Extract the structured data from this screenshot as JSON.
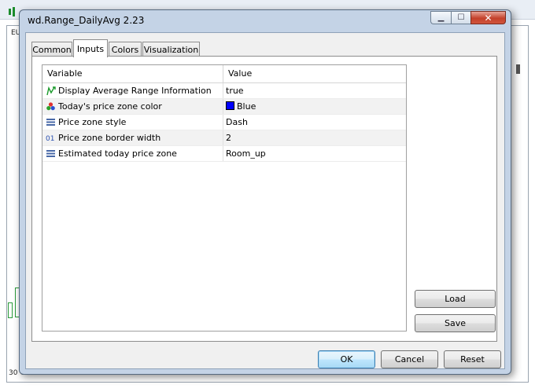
{
  "window": {
    "title": "wd.Range_DailyAvg 2.23",
    "minimize_glyph": "▁",
    "maximize_glyph": "☐",
    "close_glyph": "✕"
  },
  "background": {
    "chart_label_top": "EU",
    "chart_label_bottom": "30 C"
  },
  "tabs": [
    {
      "label": "Common",
      "active": false
    },
    {
      "label": "Inputs",
      "active": true
    },
    {
      "label": "Colors",
      "active": false
    },
    {
      "label": "Visualization",
      "active": false
    }
  ],
  "grid": {
    "headers": {
      "variable": "Variable",
      "value": "Value"
    },
    "rows": [
      {
        "icon": "bool-arrow-icon",
        "variable": "Display Average Range Information",
        "value": "true"
      },
      {
        "icon": "color-dots-icon",
        "variable": "Today's price zone color",
        "value": "Blue",
        "swatch": "#0000ff"
      },
      {
        "icon": "enum-list-icon",
        "variable": "Price zone style",
        "value": "Dash"
      },
      {
        "icon": "int-01-icon",
        "variable": "Price zone border width",
        "value": "2"
      },
      {
        "icon": "enum-list-icon",
        "variable": "Estimated today price zone",
        "value": "Room_up"
      }
    ]
  },
  "buttons": {
    "load": "Load",
    "save": "Save",
    "ok": "OK",
    "cancel": "Cancel",
    "reset": "Reset"
  },
  "colors": {
    "dialog_frame": "#c4d3e6",
    "swatch_blue": "#0000ff",
    "default_button_border": "#3c7fb1"
  }
}
